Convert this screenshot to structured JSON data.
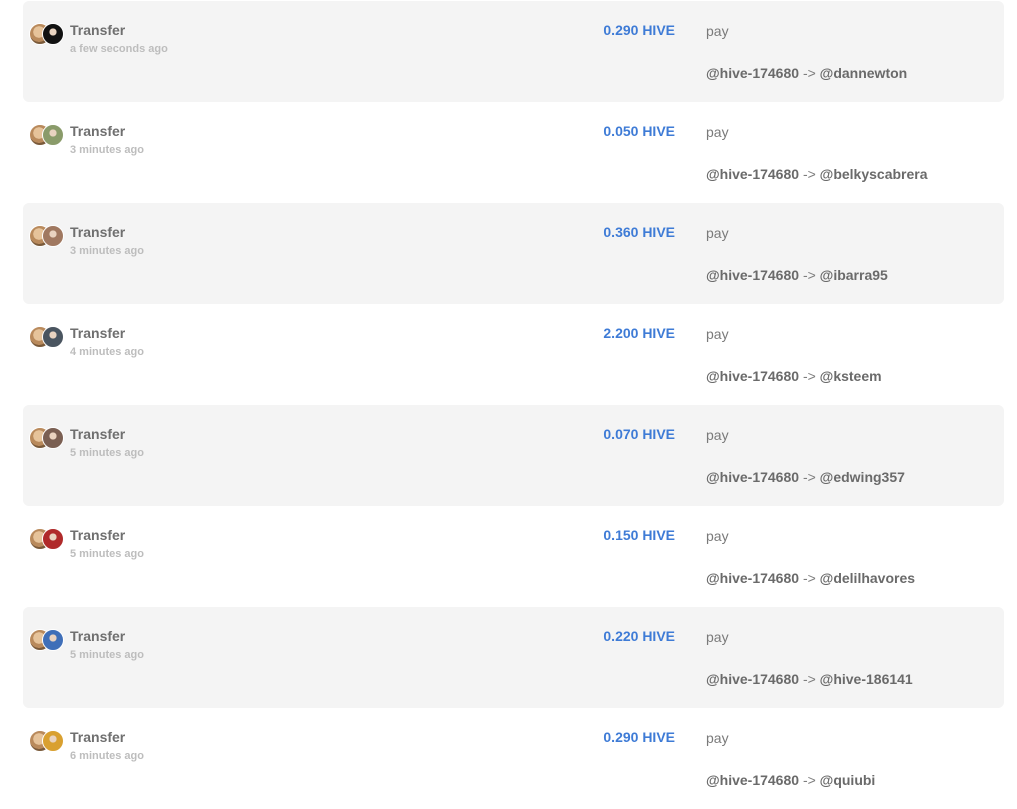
{
  "colors": {
    "amount": "#3e7bd6",
    "row_shaded": "#f4f4f4",
    "text_primary": "#6f6f6f",
    "text_muted": "#bdbdbd"
  },
  "transactions": [
    {
      "type": "Transfer",
      "time": "a few seconds ago",
      "amount": "0.290 HIVE",
      "memo": "pay",
      "from": "@hive-174680",
      "arrow": "->",
      "to": "@dannewton",
      "to_avatar_color": "#111111"
    },
    {
      "type": "Transfer",
      "time": "3 minutes ago",
      "amount": "0.050 HIVE",
      "memo": "pay",
      "from": "@hive-174680",
      "arrow": "->",
      "to": "@belkyscabrera",
      "to_avatar_color": "#8a9b6a"
    },
    {
      "type": "Transfer",
      "time": "3 minutes ago",
      "amount": "0.360 HIVE",
      "memo": "pay",
      "from": "@hive-174680",
      "arrow": "->",
      "to": "@ibarra95",
      "to_avatar_color": "#a07860"
    },
    {
      "type": "Transfer",
      "time": "4 minutes ago",
      "amount": "2.200 HIVE",
      "memo": "pay",
      "from": "@hive-174680",
      "arrow": "->",
      "to": "@ksteem",
      "to_avatar_color": "#4a5560"
    },
    {
      "type": "Transfer",
      "time": "5 minutes ago",
      "amount": "0.070 HIVE",
      "memo": "pay",
      "from": "@hive-174680",
      "arrow": "->",
      "to": "@edwing357",
      "to_avatar_color": "#7a5f52"
    },
    {
      "type": "Transfer",
      "time": "5 minutes ago",
      "amount": "0.150 HIVE",
      "memo": "pay",
      "from": "@hive-174680",
      "arrow": "->",
      "to": "@delilhavores",
      "to_avatar_color": "#b02a2a"
    },
    {
      "type": "Transfer",
      "time": "5 minutes ago",
      "amount": "0.220 HIVE",
      "memo": "pay",
      "from": "@hive-174680",
      "arrow": "->",
      "to": "@hive-186141",
      "to_avatar_color": "#3f6fb8"
    },
    {
      "type": "Transfer",
      "time": "6 minutes ago",
      "amount": "0.290 HIVE",
      "memo": "pay",
      "from": "@hive-174680",
      "arrow": "->",
      "to": "@quiubi",
      "to_avatar_color": "#d9a030"
    }
  ]
}
